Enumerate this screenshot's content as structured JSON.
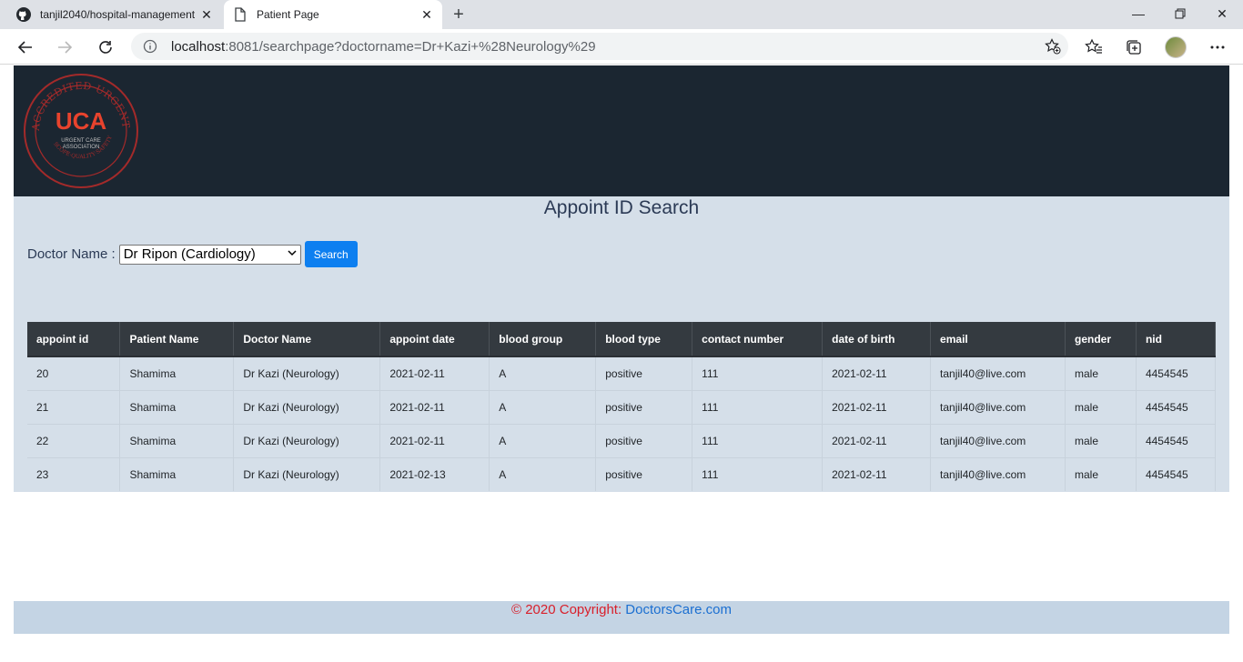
{
  "browser": {
    "tabs": [
      {
        "title": "tanjil2040/hospital-management",
        "active": false
      },
      {
        "title": "Patient Page",
        "active": true
      }
    ],
    "url_host": "localhost",
    "url_rest": ":8081/searchpage?doctorname=Dr+Kazi+%28Neurology%29"
  },
  "page": {
    "title": "Appoint ID Search",
    "doctor_label": "Doctor Name :",
    "doctor_selected": "Dr Ripon (Cardiology)",
    "search_label": "Search"
  },
  "table": {
    "headers": [
      "appoint id",
      "Patient Name",
      "Doctor Name",
      "appoint date",
      "blood group",
      "blood type",
      "contact number",
      "date of birth",
      "email",
      "gender",
      "nid"
    ],
    "rows": [
      [
        "20",
        "Shamima",
        "Dr Kazi (Neurology)",
        "2021-02-11",
        "A",
        "positive",
        "111",
        "2021-02-11",
        "tanjil40@live.com",
        "male",
        "4454545"
      ],
      [
        "21",
        "Shamima",
        "Dr Kazi (Neurology)",
        "2021-02-11",
        "A",
        "positive",
        "111",
        "2021-02-11",
        "tanjil40@live.com",
        "male",
        "4454545"
      ],
      [
        "22",
        "Shamima",
        "Dr Kazi (Neurology)",
        "2021-02-11",
        "A",
        "positive",
        "111",
        "2021-02-11",
        "tanjil40@live.com",
        "male",
        "4454545"
      ],
      [
        "23",
        "Shamima",
        "Dr Kazi (Neurology)",
        "2021-02-13",
        "A",
        "positive",
        "111",
        "2021-02-11",
        "tanjil40@live.com",
        "male",
        "4454545"
      ]
    ]
  },
  "footer": {
    "copyright": "© 2020 Copyright: ",
    "link": "DoctorsCare.com"
  },
  "logo": {
    "ring_text": "ACCREDITED URGENT CARE CENTER",
    "bottom_text": "SCOPE·QUALITY·SAFETY",
    "mark": "UCA",
    "sub1": "URGENT CARE",
    "sub2": "ASSOCIATION"
  },
  "colors": {
    "header_bg": "#1b2631",
    "content_bg": "#d5dfe9",
    "button_bg": "#0d7ff0",
    "table_head_bg": "#343a40",
    "footer_bg": "#c4d4e4",
    "footer_text": "#d91f2a",
    "footer_link": "#1b6fd1"
  }
}
